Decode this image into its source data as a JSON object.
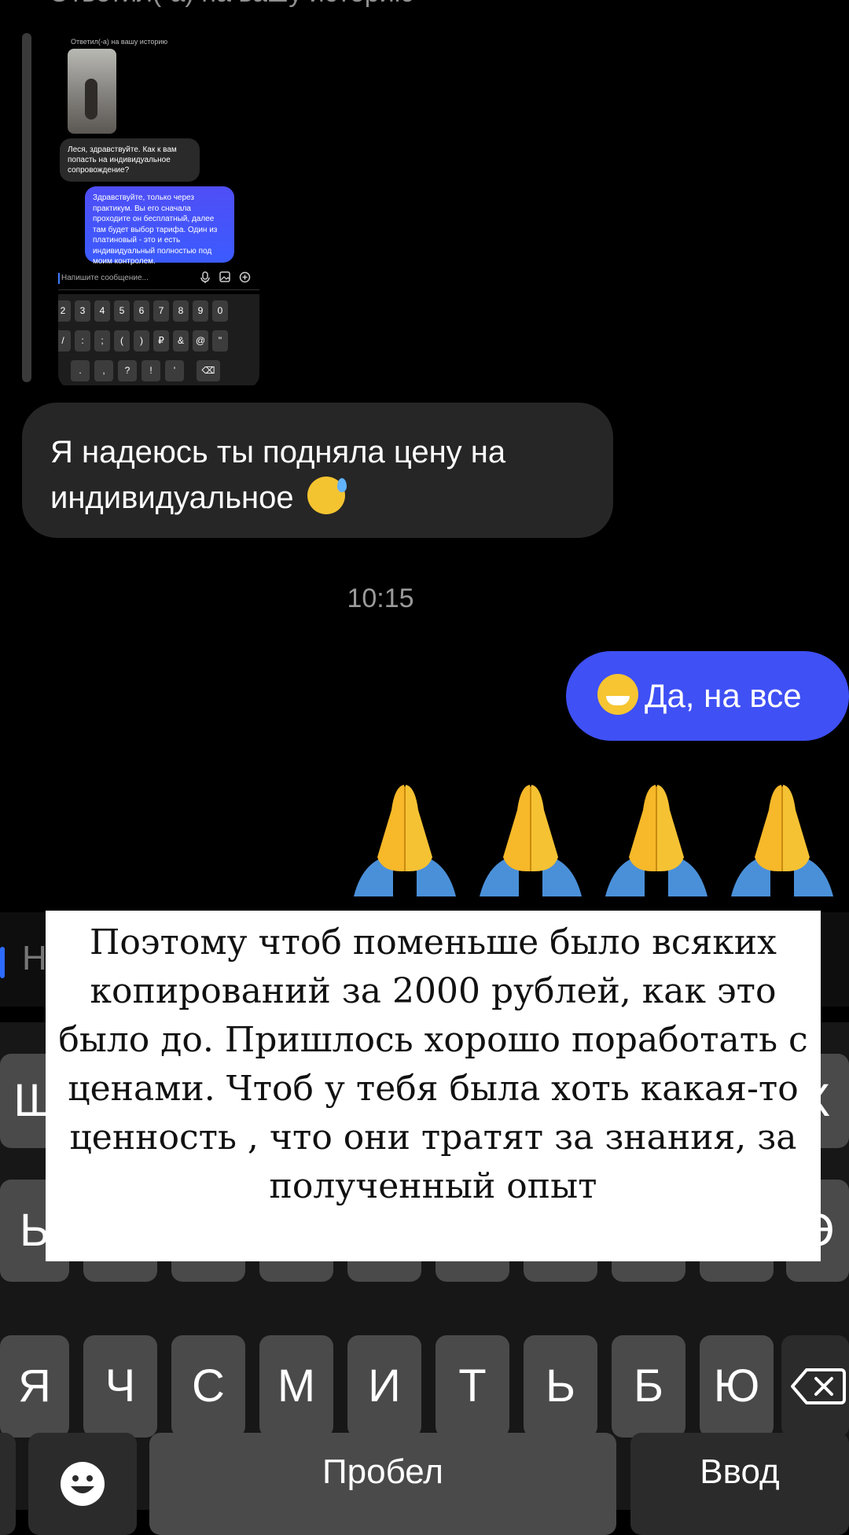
{
  "story": {
    "header": "Ответил(-а) на вашу историю",
    "preview": {
      "title": "Ответил(-а) на вашу историю",
      "incoming": "Леся, здравствуйте. Как к вам попасть на индивидуальное сопровождение?",
      "outgoing": "Здравствуйте, только через практикум. Вы его сначала проходите он бесплатный, далее там будет выбор тарифа. Один из платиновый - это и есть индивидуальный полностью под моим контролем.",
      "input_placeholder": "Напишите сообщение...",
      "icons": [
        "mic-icon",
        "image-icon",
        "plus-circle-icon"
      ],
      "keys_row1": [
        "2",
        "3",
        "4",
        "5",
        "6",
        "7",
        "8",
        "9",
        "0"
      ],
      "keys_row2": [
        "/",
        ":",
        ";",
        "(",
        ")",
        "₽",
        "&",
        "@",
        "\""
      ],
      "keys_row3": [
        ".",
        ",",
        "?",
        "!",
        "'"
      ]
    }
  },
  "chat": {
    "incoming_message": "Я надеюсь ты подняла цену на индивидуальное",
    "timestamp": "10:15",
    "outgoing_message": "Да, на все",
    "emoji_reactions": [
      "pray-emoji",
      "pray-emoji",
      "pray-emoji",
      "pray-emoji"
    ]
  },
  "input": {
    "partial_text": "Н"
  },
  "keyboard": {
    "row_partial_left": "Ш",
    "row_partial_right": "Х",
    "row2_left": "Ь",
    "row2_right": "Э",
    "row3": [
      "Я",
      "Ч",
      "С",
      "М",
      "И",
      "Т",
      "Ь",
      "Б",
      "Ю"
    ],
    "backspace_icon": "backspace-icon",
    "emoji_icon": "emoji-face-icon",
    "space_label": "Пробел",
    "enter_label": "Ввод"
  },
  "caption": {
    "text": "Поэтому чтоб поменьше было всяких копирований за 2000 рублей, как это было до. Пришлось хорошо поработать с ценами. Чтоб у тебя была хоть какая-то ценность , что они тратят за знания, за полученный опыт"
  },
  "colors": {
    "background": "#000000",
    "outgoing_bubble": "#3f50f5",
    "incoming_bubble": "#262626",
    "caption_bg": "#ffffff"
  }
}
